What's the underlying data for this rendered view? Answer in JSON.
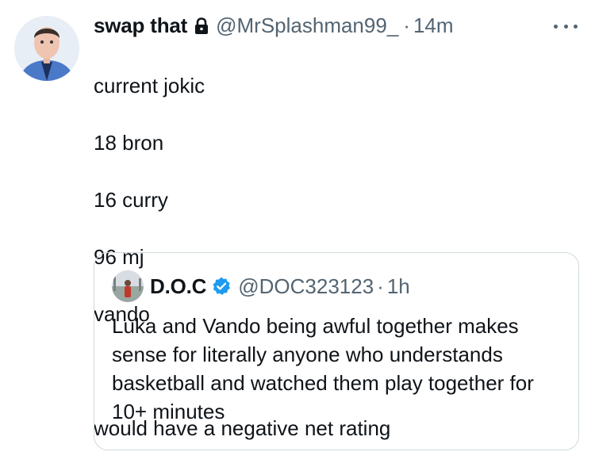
{
  "tweet": {
    "display_name": "swap that",
    "handle": "@MrSplashman99_",
    "separator": "·",
    "time": "14m",
    "lines": [
      "current jokic",
      "18 bron",
      "16 curry",
      "96 mj",
      "vando",
      "",
      "would have a negative net rating"
    ]
  },
  "quote": {
    "display_name": "D.O.C",
    "handle": "@DOC323123",
    "separator": "·",
    "time": "1h",
    "text": "Luka and Vando being awful together makes sense for literally anyone who understands basketball and watched them play together for 10+ minutes"
  },
  "colors": {
    "text": "#0f1419",
    "secondary": "#536471",
    "verified": "#1d9bf0",
    "border": "#cfd9de"
  },
  "icons": {
    "lock": "lock-icon",
    "verified": "verified-badge-icon",
    "more": "more-options-icon"
  }
}
